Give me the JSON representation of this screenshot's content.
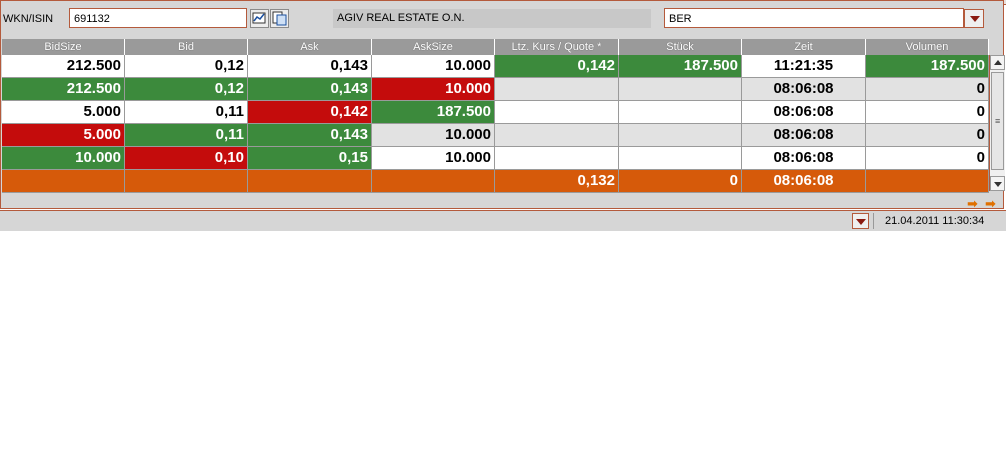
{
  "search": {
    "wkn_label": "WKN/ISIN",
    "wkn_value": "691132",
    "security_name": "AGIV REAL ESTATE O.N.",
    "exchange_value": "BER"
  },
  "columns": [
    "BidSize",
    "Bid",
    "Ask",
    "AskSize",
    "Ltz. Kurs / Quote *",
    "Stück",
    "Zeit",
    "Volumen"
  ],
  "rows": [
    {
      "cells": [
        "212.500",
        "0,12",
        "0,143",
        "10.000",
        "0,142",
        "187.500",
        "11:21:35",
        "187.500"
      ],
      "colors": [
        "w",
        "w",
        "w",
        "w",
        "g",
        "g",
        "w",
        "g"
      ]
    },
    {
      "cells": [
        "212.500",
        "0,12",
        "0,143",
        "10.000",
        "",
        "",
        "08:06:08",
        "0"
      ],
      "colors": [
        "g",
        "g",
        "g",
        "r",
        "e",
        "e",
        "e",
        "e"
      ]
    },
    {
      "cells": [
        "5.000",
        "0,11",
        "0,142",
        "187.500",
        "",
        "",
        "08:06:08",
        "0"
      ],
      "colors": [
        "w",
        "w",
        "r",
        "g",
        "w",
        "w",
        "w",
        "w"
      ]
    },
    {
      "cells": [
        "5.000",
        "0,11",
        "0,143",
        "10.000",
        "",
        "",
        "08:06:08",
        "0"
      ],
      "colors": [
        "r",
        "g",
        "g",
        "e",
        "e",
        "e",
        "e",
        "e"
      ]
    },
    {
      "cells": [
        "10.000",
        "0,10",
        "0,15",
        "10.000",
        "",
        "",
        "08:06:08",
        "0"
      ],
      "colors": [
        "g",
        "r",
        "g",
        "w",
        "w",
        "w",
        "w",
        "w"
      ]
    },
    {
      "cells": [
        "",
        "",
        "",
        "",
        "0,132",
        "0",
        "08:06:08",
        ""
      ],
      "colors": [
        "o",
        "o",
        "o",
        "o",
        "o",
        "o",
        "o",
        "o"
      ]
    }
  ],
  "status": {
    "datetime": "21.04.2011 11:30:34"
  },
  "colors": {
    "green": "#3c8a3c",
    "red": "#c40c0c",
    "orange": "#d65a0a",
    "border": "#b45a3c"
  },
  "icons": [
    "chart-icon",
    "detail-icon",
    "dropdown-arrow-icon",
    "next-arrow-icon",
    "last-arrow-icon"
  ]
}
